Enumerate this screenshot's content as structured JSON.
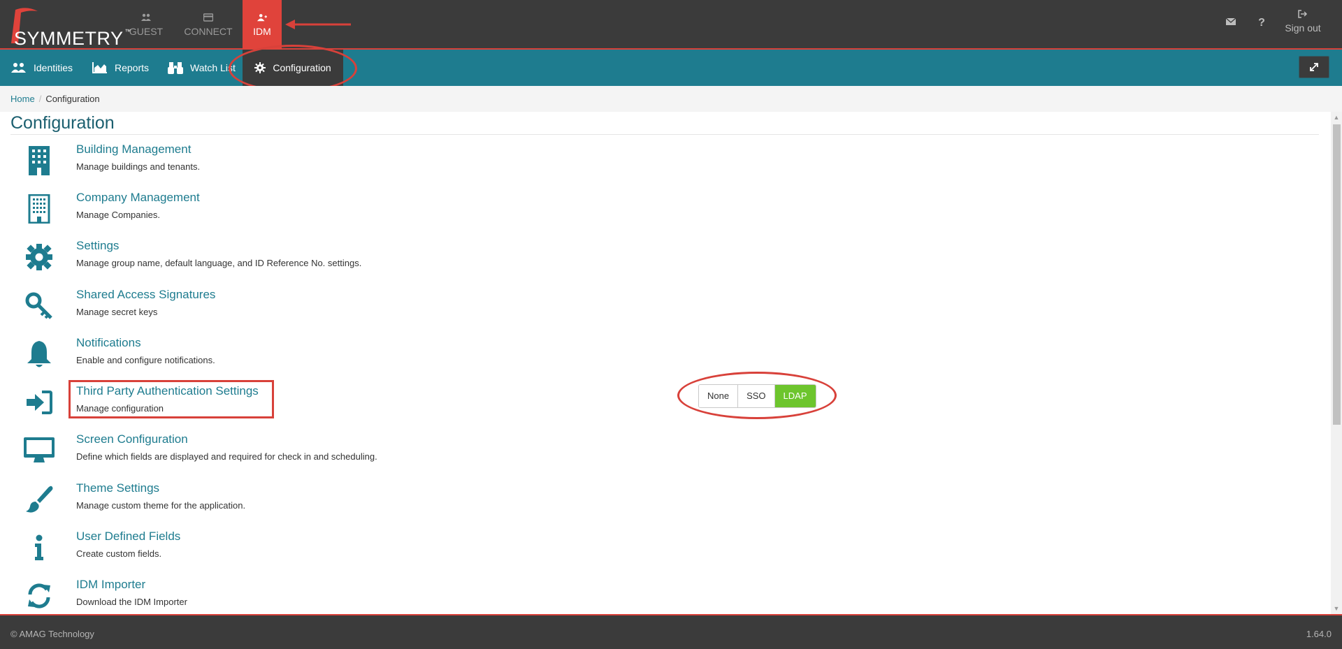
{
  "topnav": {
    "logo_text": "SYMMETRY",
    "logo_tm": "™",
    "guest": "GUEST",
    "connect": "CONNECT",
    "idm": "IDM",
    "signout": "Sign out"
  },
  "subnav": {
    "identities": "Identities",
    "reports": "Reports",
    "watchlist": "Watch List",
    "configuration": "Configuration"
  },
  "breadcrumb": {
    "home": "Home",
    "sep": "/",
    "current": "Configuration"
  },
  "page_title": "Configuration",
  "items": [
    {
      "title": "Building Management",
      "desc": "Manage buildings and tenants.",
      "icon": "building-icon"
    },
    {
      "title": "Company Management",
      "desc": "Manage Companies.",
      "icon": "company-building-icon"
    },
    {
      "title": "Settings",
      "desc": "Manage group name, default language, and ID Reference No. settings.",
      "icon": "gear-icon"
    },
    {
      "title": "Shared Access Signatures",
      "desc": "Manage secret keys",
      "icon": "key-icon"
    },
    {
      "title": "Notifications",
      "desc": "Enable and configure notifications.",
      "icon": "bell-icon"
    },
    {
      "title": "Third Party Authentication Settings",
      "desc": "Manage configuration",
      "icon": "sign-in-icon"
    },
    {
      "title": "Screen Configuration",
      "desc": "Define which fields are displayed and required for check in and scheduling.",
      "icon": "monitor-icon"
    },
    {
      "title": "Theme Settings",
      "desc": "Manage custom theme for the application.",
      "icon": "paint-brush-icon"
    },
    {
      "title": "User Defined Fields",
      "desc": "Create custom fields.",
      "icon": "info-icon"
    },
    {
      "title": "IDM Importer",
      "desc": "Download the IDM Importer",
      "icon": "refresh-icon"
    }
  ],
  "auth_toggle": {
    "none": "None",
    "sso": "SSO",
    "ldap": "LDAP",
    "selected": "LDAP"
  },
  "colors": {
    "accent": "#1e7c8f",
    "topbar": "#3b3b3b",
    "active_red": "#e0433b",
    "annotation": "#d8413a",
    "selected_green": "#6dc52d"
  },
  "footer": {
    "copyright": "© AMAG Technology",
    "version": "1.64.0"
  }
}
